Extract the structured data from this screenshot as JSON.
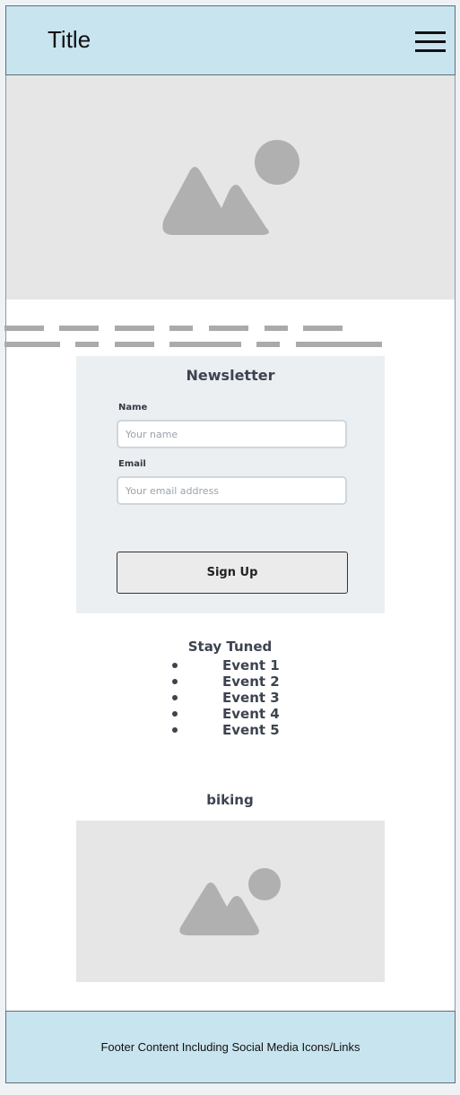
{
  "header": {
    "title": "Title",
    "menu_icon": "hamburger-menu-icon"
  },
  "hero": {
    "icon": "image-placeholder-icon"
  },
  "newsletter": {
    "title": "Newsletter",
    "name_label": "Name",
    "name_placeholder": "Your name",
    "name_value": "",
    "email_label": "Email",
    "email_placeholder": "Your email address",
    "email_value": "",
    "button_label": "Sign Up"
  },
  "events": {
    "title": "Stay Tuned",
    "items": [
      "Event 1",
      "Event 2",
      "Event 3",
      "Event 4",
      "Event 5"
    ]
  },
  "biking": {
    "title": "biking",
    "icon": "image-placeholder-icon"
  },
  "footer": {
    "text": "Footer Content Including Social Media Icons/Links"
  },
  "colors": {
    "header_bg": "#c8e4ef",
    "placeholder_bg": "#e6e6e6",
    "placeholder_glyph": "#b0b0b0",
    "newsletter_bg": "#ebeff2",
    "text_dark": "#3d4350"
  }
}
